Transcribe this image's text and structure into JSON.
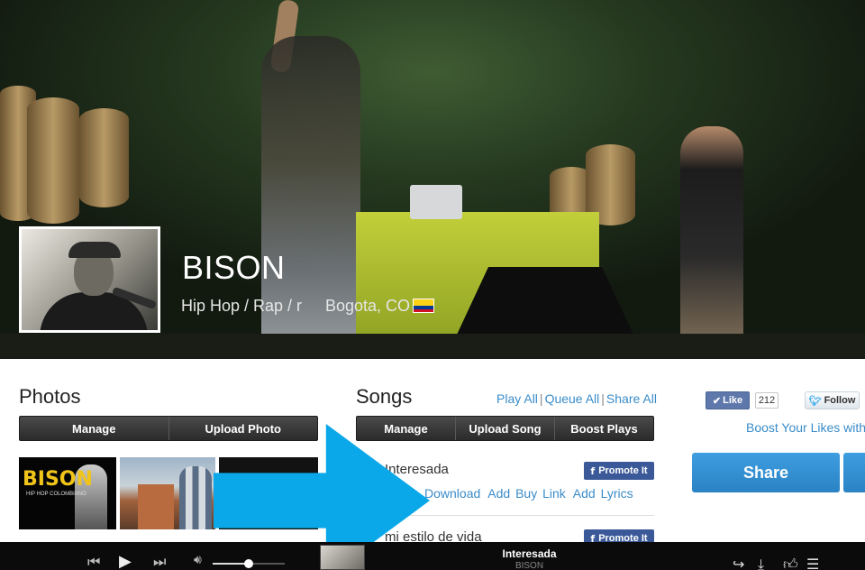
{
  "artist": {
    "name": "BISON",
    "genre": "Hip Hop / Rap / r",
    "location": "Bogota, CO"
  },
  "photos": {
    "title": "Photos",
    "buttons": [
      "Manage",
      "Upload Photo"
    ],
    "thumb1_text": "BISON",
    "thumb1_sub": "HIP HOP COLOMBIANO"
  },
  "songs": {
    "title": "Songs",
    "links": [
      "Play All",
      "Queue All",
      "Share All"
    ],
    "buttons": [
      "Manage",
      "Upload Song",
      "Boost Plays"
    ],
    "list": [
      {
        "title": "Interesada",
        "promote": "Promote It"
      },
      {
        "title": "mi estilo de vida",
        "promote": "Promote It"
      }
    ],
    "actions": [
      "Download",
      "Add Buy Link",
      "Add Lyrics"
    ]
  },
  "social": {
    "like_label": "Like",
    "like_count": "212",
    "follow_label": "Follow",
    "boost_text": "Boost Your Likes with",
    "share_label": "Share"
  },
  "player": {
    "title": "Interesada",
    "artist": "BISON",
    "volume": 0.5
  },
  "colors": {
    "accent": "#0aa8e8",
    "link": "#3a8cc8",
    "facebook": "#3b5998",
    "share": "#2a82c4"
  }
}
